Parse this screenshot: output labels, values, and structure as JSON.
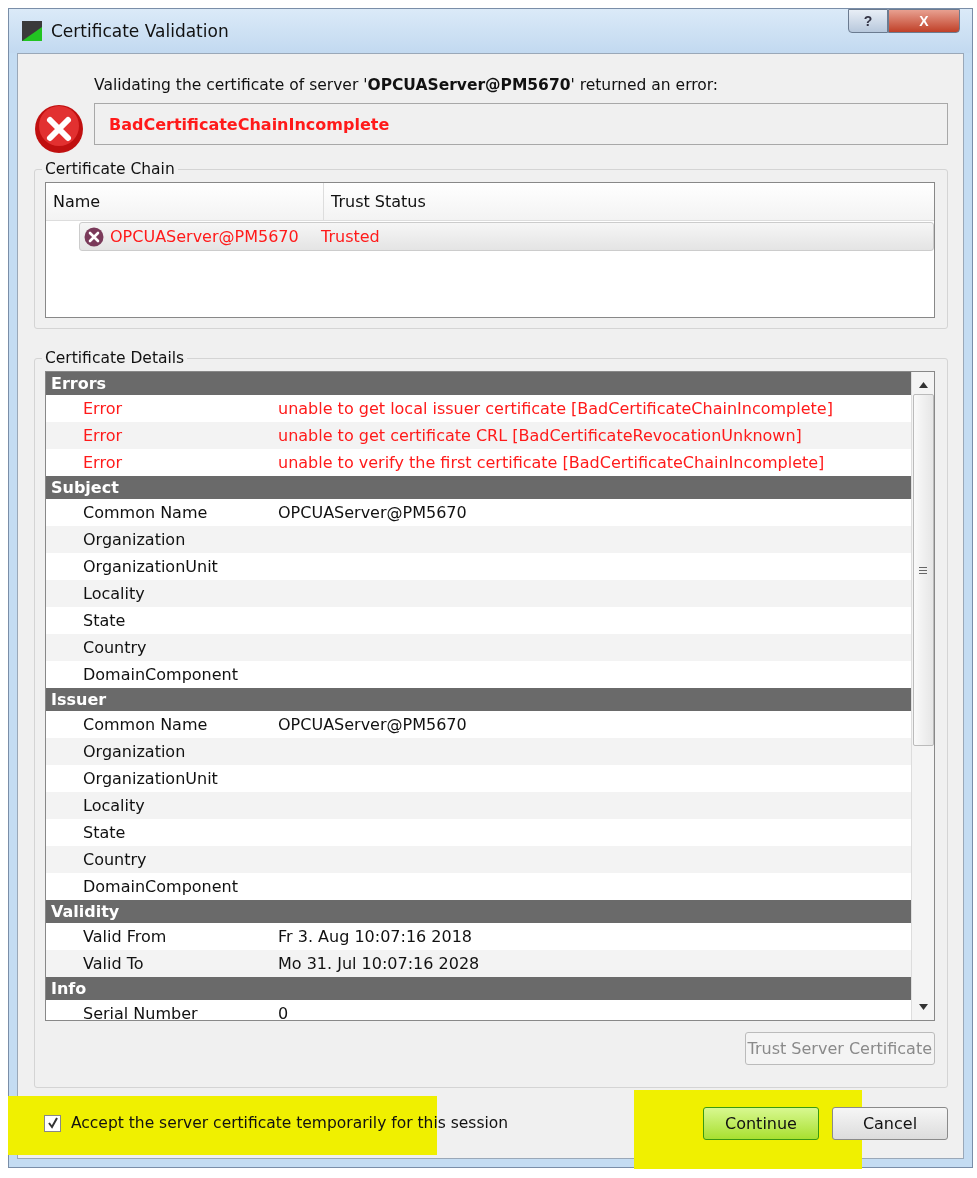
{
  "window": {
    "title": "Certificate Validation",
    "help_button": "?",
    "close_button": "X"
  },
  "message": {
    "text": "Validating the certificate of server '**OPCUAServer@PM5670**' returned an error:",
    "error": "BadCertificateChainIncomplete"
  },
  "certificate_chain": {
    "title": "Certificate Chain",
    "columns": [
      "Name",
      "Trust Status"
    ],
    "rows": [
      {
        "name": "OPCUAServer@PM5670",
        "trust_status": "Trusted",
        "selected": true,
        "error": true
      }
    ]
  },
  "certificate_details": {
    "title": "Certificate Details",
    "sections": [
      {
        "title": "Errors",
        "rows": [
          {
            "kind": "error",
            "label": "Error",
            "value": "unable to get local issuer certificate [BadCertificateChainIncomplete]"
          },
          {
            "kind": "error",
            "label": "Error",
            "value": "unable to get certificate CRL [BadCertificateRevocationUnknown]"
          },
          {
            "kind": "error",
            "label": "Error",
            "value": "unable to verify the first certificate [BadCertificateChainIncomplete]"
          }
        ]
      },
      {
        "title": "Subject",
        "rows": [
          {
            "kind": "field",
            "label": "Common Name",
            "value": "OPCUAServer@PM5670"
          },
          {
            "kind": "field",
            "label": "Organization"
          },
          {
            "kind": "field",
            "label": "OrganizationUnit"
          },
          {
            "kind": "field",
            "label": "Locality"
          },
          {
            "kind": "field",
            "label": "State"
          },
          {
            "kind": "field",
            "label": "Country"
          },
          {
            "kind": "field",
            "label": "DomainComponent"
          }
        ]
      },
      {
        "title": "Issuer",
        "rows": [
          {
            "kind": "field",
            "label": "Common Name",
            "value": "OPCUAServer@PM5670"
          },
          {
            "kind": "field",
            "label": "Organization"
          },
          {
            "kind": "field",
            "label": "OrganizationUnit"
          },
          {
            "kind": "field",
            "label": "Locality"
          },
          {
            "kind": "field",
            "label": "State"
          },
          {
            "kind": "field",
            "label": "Country"
          },
          {
            "kind": "field",
            "label": "DomainComponent"
          }
        ]
      },
      {
        "title": "Validity",
        "rows": [
          {
            "kind": "field",
            "label": "Valid From",
            "value": "Fr 3. Aug 10:07:16 2018"
          },
          {
            "kind": "field",
            "label": "Valid To",
            "value": "Mo 31. Jul 10:07:16 2028"
          }
        ]
      },
      {
        "title": "Info",
        "rows": [
          {
            "kind": "field",
            "label": "Serial Number",
            "value": "0"
          }
        ]
      }
    ]
  },
  "trust_button": {
    "label": "Trust Server Certificate",
    "disabled": true
  },
  "accept_checkbox": {
    "label": "Accept the server certificate temporarily for this session",
    "checked": true
  },
  "buttons": [
    {
      "label": "Continue",
      "default": true
    },
    {
      "label": "Cancel",
      "default": false
    }
  ]
}
